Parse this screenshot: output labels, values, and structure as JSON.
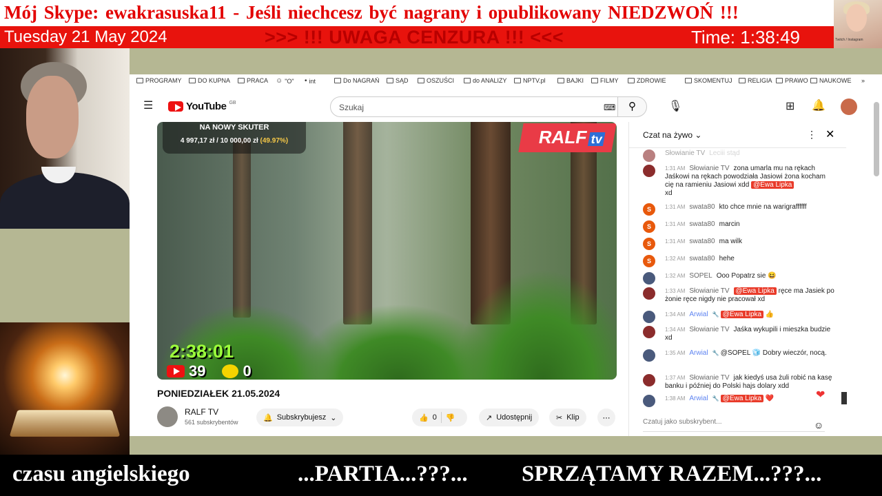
{
  "overlay": {
    "top_banner": "Mój Skype: ewakrasuska11 - Jeśli  niechcesz  być  nagrany  i  opublikowany  NIEDZWOŃ !!!",
    "date": "Tuesday 21 May 2024",
    "warning": ">>> !!! UWAGA  CENZURA !!! <<<",
    "time": "Time: 1:38:49",
    "ticker": [
      "czasu  angielskiego",
      "...PARTIA...???...",
      "SPRZĄTAMY  RAZEM...???..."
    ],
    "thumb_caption": "Twitch / Instagram"
  },
  "bookmarks": [
    {
      "label": "PROGRAMY",
      "icon": "folder-icon"
    },
    {
      "label": "DO KUPNA",
      "icon": "folder-icon"
    },
    {
      "label": "PRACA",
      "icon": "folder-icon"
    },
    {
      "label": "\"O\"",
      "icon": "emoji-icon"
    },
    {
      "label": "int",
      "icon": "site-icon"
    },
    {
      "label": "Do NAGRAŃ",
      "icon": "folder-icon"
    },
    {
      "label": "SĄD",
      "icon": "folder-icon"
    },
    {
      "label": "OSZUŚCI",
      "icon": "folder-icon"
    },
    {
      "label": "do ANALIZY",
      "icon": "folder-icon"
    },
    {
      "label": "NPTV.pl",
      "icon": "folder-icon"
    },
    {
      "label": "BAJKI",
      "icon": "folder-icon"
    },
    {
      "label": "FILMY",
      "icon": "folder-icon"
    },
    {
      "label": "ZDROWIE",
      "icon": "folder-icon"
    },
    {
      "label": "SKOMENTUJ",
      "icon": "folder-icon"
    },
    {
      "label": "RELIGIA",
      "icon": "folder-icon"
    },
    {
      "label": "PRAWO",
      "icon": "folder-icon"
    },
    {
      "label": "NAUKOWE",
      "icon": "folder-icon"
    }
  ],
  "youtube": {
    "logo": "YouTube",
    "region": "GB",
    "search_placeholder": "Szukaj"
  },
  "video": {
    "donation_title": "NA NOWY SKUTER",
    "donation_raised": "4 997,17 zł",
    "donation_goal": "/ 10 000,00 zł",
    "donation_percent_text": "(49.97%)",
    "donation_progress": 0.4997,
    "logo_main": "RALF",
    "logo_sub": "tv",
    "timer": "2:38:01",
    "yt_viewers": "39",
    "other_viewers": "0",
    "title": "PONIEDZIAŁEK 21.05.2024"
  },
  "channel": {
    "name": "RALF TV",
    "subs": "561 subskrybentów",
    "subscribe_label": "Subskrybujesz",
    "likes": "0",
    "share_label": "Udostępnij",
    "clip_label": "Klip"
  },
  "chat": {
    "header": "Czat na żywo",
    "input_placeholder": "Czatuj jako subskrybent...",
    "messages": [
      {
        "time": "",
        "author": "Słowianie TV",
        "avatar": "r",
        "text": "",
        "partial": "Leciii stąd"
      },
      {
        "time": "1:31 AM",
        "author": "Słowianie TV",
        "avatar": "r",
        "text": "zona umarla mu na rękach Jaśkowi na rękach powodziała Jasiowi żona kocham cię na ramieniu Jasiowi xdd",
        "mention": "@Ewa Lipka",
        "after": "xd"
      },
      {
        "time": "1:31 AM",
        "author": "swata80",
        "avatar": "o",
        "letter": "S",
        "text": "kto chce mnie na warigraffffff"
      },
      {
        "time": "1:31 AM",
        "author": "swata80",
        "avatar": "o",
        "letter": "S",
        "text": "marcin"
      },
      {
        "time": "1:31 AM",
        "author": "swata80",
        "avatar": "o",
        "letter": "S",
        "text": "ma wilk"
      },
      {
        "time": "1:32 AM",
        "author": "swata80",
        "avatar": "o",
        "letter": "S",
        "text": "hehe"
      },
      {
        "time": "1:32 AM",
        "author": "SOPEL",
        "avatar": "b",
        "text": "Ooo Popatrz sie 😆"
      },
      {
        "time": "1:33 AM",
        "author": "Słowianie TV",
        "avatar": "r",
        "mention": "@Ewa Lipka",
        "text": "ręce ma Jasiek po żonie ręce nigdy nie pracował xd"
      },
      {
        "time": "1:34 AM",
        "author": "Arwial",
        "avatar": "b",
        "mod": true,
        "mention": "@Ewa Lipka",
        "text": "👍"
      },
      {
        "time": "1:34 AM",
        "author": "Słowianie TV",
        "avatar": "r",
        "text": "Jaśka wykupili i mieszka budzie xd"
      },
      {
        "time": "1:35 AM",
        "author": "Arwial",
        "avatar": "b",
        "mod": true,
        "text": "@SOPEL 🧊 Dobry wieczór, nocą."
      },
      {
        "time": "1:37 AM",
        "author": "Słowianie TV",
        "avatar": "r",
        "text": "jak kiedyś usa żuli robić na kasę banku i później do Polski hajs dolary xdd"
      },
      {
        "time": "1:38 AM",
        "author": "Arwial",
        "avatar": "b",
        "mod": true,
        "mention": "@Ewa Lipka",
        "text": "❤️"
      }
    ]
  },
  "colors": {
    "banner_red": "#e30000",
    "bar_red": "#e8130d",
    "mention_red": "#e93b2a",
    "moderator_blue": "#5e84f1"
  }
}
